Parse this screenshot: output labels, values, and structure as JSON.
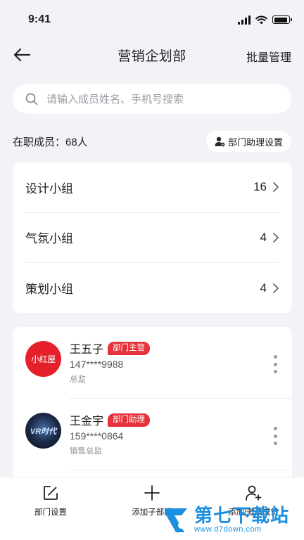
{
  "status_bar": {
    "time": "9:41",
    "battery_level": 0.9
  },
  "nav": {
    "title": "营销企划部",
    "action_label": "批量管理"
  },
  "search": {
    "placeholder": "请输入成员姓名、手机号搜索"
  },
  "summary": {
    "member_count_text": "在职成员：68人",
    "assistant_settings_label": "部门助理设置"
  },
  "groups": [
    {
      "name": "设计小组",
      "count": "16"
    },
    {
      "name": "气氛小组",
      "count": "4"
    },
    {
      "name": "策划小组",
      "count": "4"
    }
  ],
  "members": [
    {
      "name": "王五子",
      "badge": "部门主管",
      "phone": "147****9988",
      "title": "总监",
      "avatar_text": "小红屋"
    },
    {
      "name": "王金宇",
      "badge": "部门助理",
      "phone": "159****0864",
      "title": "销售总监",
      "avatar_text": "VR时代"
    }
  ],
  "tab_bar": {
    "items": [
      {
        "label": "部门设置",
        "icon": "edit-icon"
      },
      {
        "label": "添加子部门",
        "icon": "plus-icon"
      },
      {
        "label": "添加/邀请成员",
        "icon": "add-user-icon"
      }
    ]
  },
  "watermark": {
    "title": "第七下载站",
    "url": "www.d7down.com"
  },
  "colors": {
    "accent": "#e5323b",
    "background": "#f2f3f7",
    "watermark": "#1b8fe0"
  }
}
